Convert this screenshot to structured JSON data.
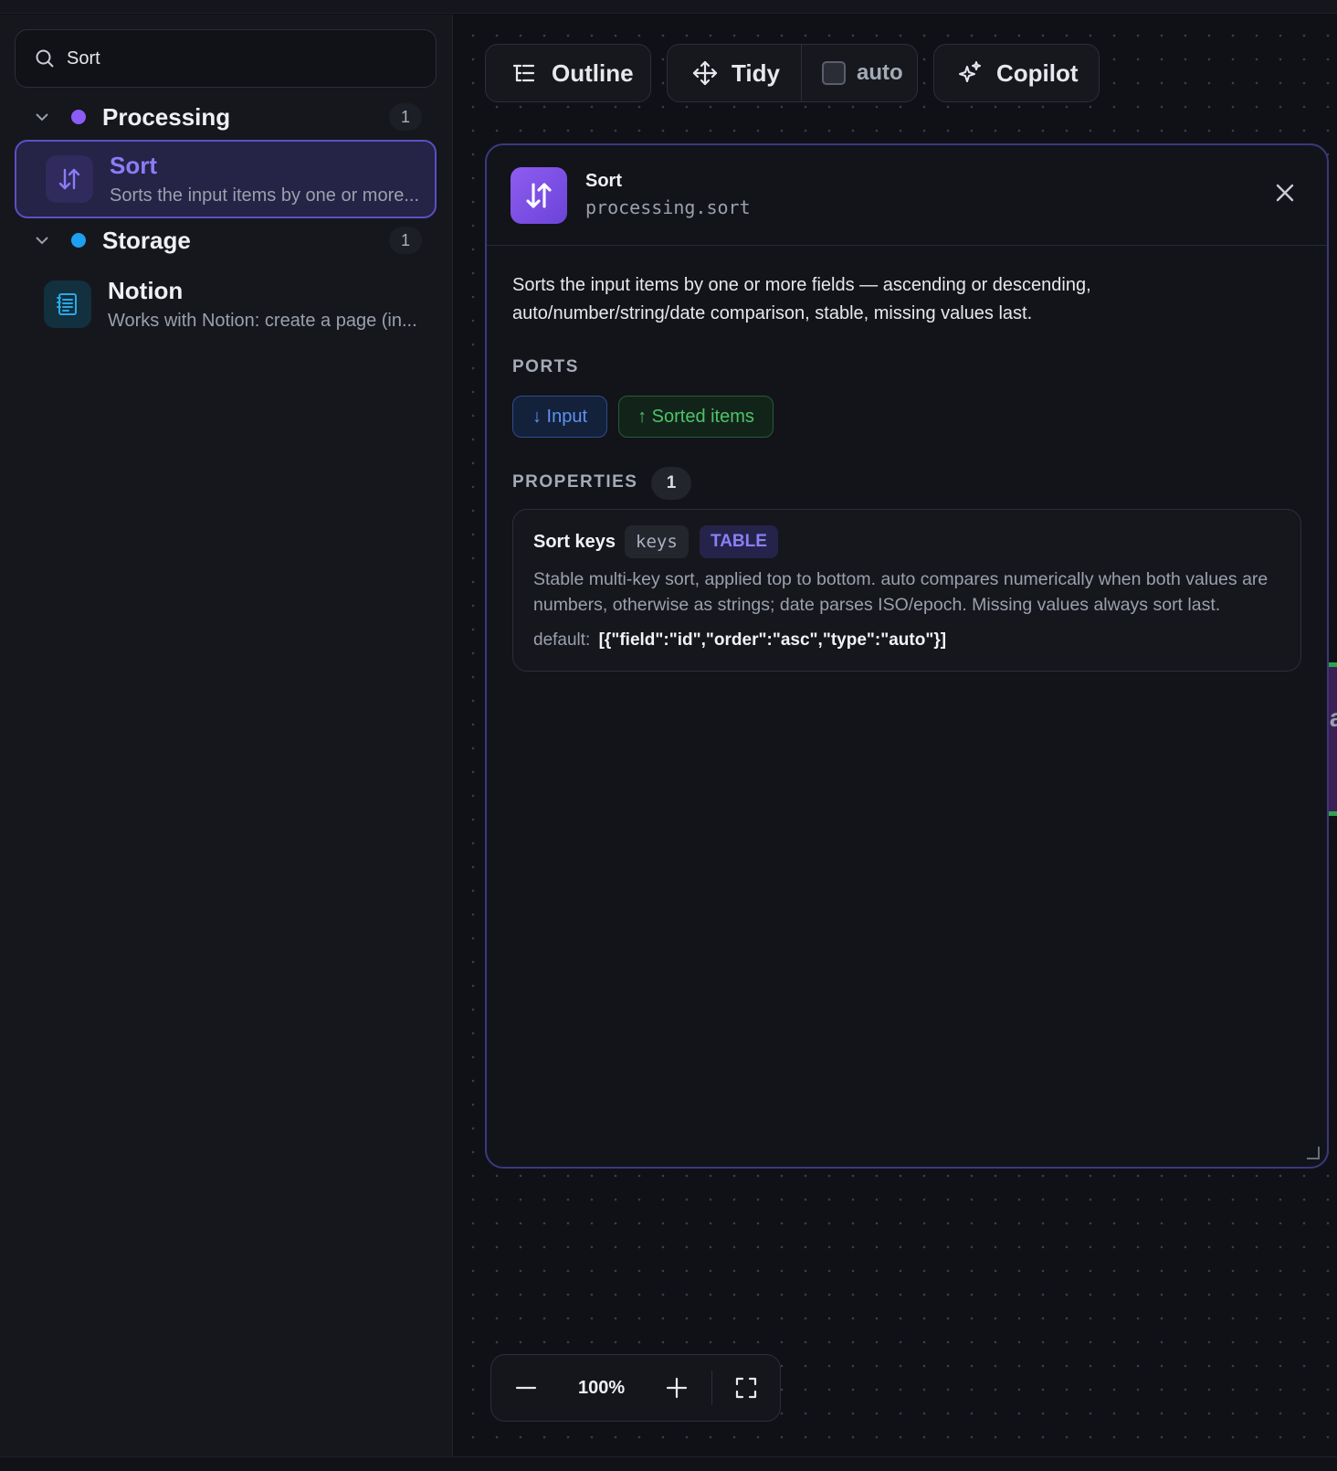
{
  "search": {
    "value": "Sort",
    "placeholder": ""
  },
  "sidebar": {
    "groups": [
      {
        "title": "Processing",
        "count": "1",
        "color": "#8b5cf6",
        "items": [
          {
            "title": "Sort",
            "description": "Sorts the input items by one or more...",
            "icon": "sort-arrows-icon",
            "selected": true
          }
        ]
      },
      {
        "title": "Storage",
        "count": "1",
        "color": "#1ea0f2",
        "items": [
          {
            "title": "Notion",
            "description": "Works with Notion: create a page (in...",
            "icon": "notion-doc-icon",
            "selected": false
          }
        ]
      }
    ]
  },
  "toolbar": {
    "outline": "Outline",
    "tidy": "Tidy",
    "auto": "auto",
    "copilot": "Copilot"
  },
  "panel": {
    "title": "Sort",
    "subtitle": "processing.sort",
    "description": "Sorts the input items by one or more fields — ascending or descending, auto/number/string/date comparison, stable, missing values last.",
    "ports_label": "PORTS",
    "ports": {
      "input": "↓ Input",
      "output": "↑ Sorted items"
    },
    "properties_label": "PROPERTIES",
    "properties_count": "1",
    "property": {
      "name": "Sort keys",
      "key": "keys",
      "type": "TABLE",
      "description": "Stable multi-key sort, applied top to bottom. auto compares numerically when both values are numbers, otherwise as strings; date parses ISO/epoch. Missing values always sort last.",
      "default_label": "default:",
      "default_value": "[{\"field\":\"id\",\"order\":\"asc\",\"type\":\"auto\"}]"
    }
  },
  "canvas": {
    "peek_label": "la"
  },
  "zoom": {
    "level": "100%"
  }
}
